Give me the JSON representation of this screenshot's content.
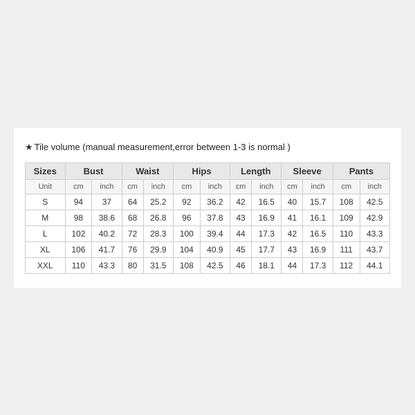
{
  "title": {
    "prefix": "★",
    "text": "Tile volume (manual measurement,error between 1-3 is normal )"
  },
  "table": {
    "headers": [
      "Sizes",
      "Bust",
      "",
      "Waist",
      "",
      "Hips",
      "",
      "Length",
      "",
      "Sleeve",
      "",
      "Pants",
      ""
    ],
    "col_headers": [
      "Sizes",
      "Bust",
      "Waist",
      "Hips",
      "Length",
      "Sleeve",
      "Pants"
    ],
    "unit_row": {
      "label": "Unit",
      "units": [
        "cm",
        "inch",
        "cm",
        "inch",
        "cm",
        "inch",
        "cm",
        "inch",
        "cm",
        "inch",
        "cm",
        "inch"
      ]
    },
    "rows": [
      {
        "size": "S",
        "bust_cm": "94",
        "bust_in": "37",
        "waist_cm": "64",
        "waist_in": "25.2",
        "hips_cm": "92",
        "hips_in": "36.2",
        "len_cm": "42",
        "len_in": "16.5",
        "sleeve_cm": "40",
        "sleeve_in": "15.7",
        "pants_cm": "108",
        "pants_in": "42.5"
      },
      {
        "size": "M",
        "bust_cm": "98",
        "bust_in": "38.6",
        "waist_cm": "68",
        "waist_in": "26.8",
        "hips_cm": "96",
        "hips_in": "37.8",
        "len_cm": "43",
        "len_in": "16.9",
        "sleeve_cm": "41",
        "sleeve_in": "16.1",
        "pants_cm": "109",
        "pants_in": "42.9"
      },
      {
        "size": "L",
        "bust_cm": "102",
        "bust_in": "40.2",
        "waist_cm": "72",
        "waist_in": "28.3",
        "hips_cm": "100",
        "hips_in": "39.4",
        "len_cm": "44",
        "len_in": "17.3",
        "sleeve_cm": "42",
        "sleeve_in": "16.5",
        "pants_cm": "110",
        "pants_in": "43.3"
      },
      {
        "size": "XL",
        "bust_cm": "106",
        "bust_in": "41.7",
        "waist_cm": "76",
        "waist_in": "29.9",
        "hips_cm": "104",
        "hips_in": "40.9",
        "len_cm": "45",
        "len_in": "17.7",
        "sleeve_cm": "43",
        "sleeve_in": "16.9",
        "pants_cm": "111",
        "pants_in": "43.7"
      },
      {
        "size": "XXL",
        "bust_cm": "110",
        "bust_in": "43.3",
        "waist_cm": "80",
        "waist_in": "31.5",
        "hips_cm": "108",
        "hips_in": "42.5",
        "len_cm": "46",
        "len_in": "18.1",
        "sleeve_cm": "44",
        "sleeve_in": "17.3",
        "pants_cm": "112",
        "pants_in": "44.1"
      }
    ]
  }
}
